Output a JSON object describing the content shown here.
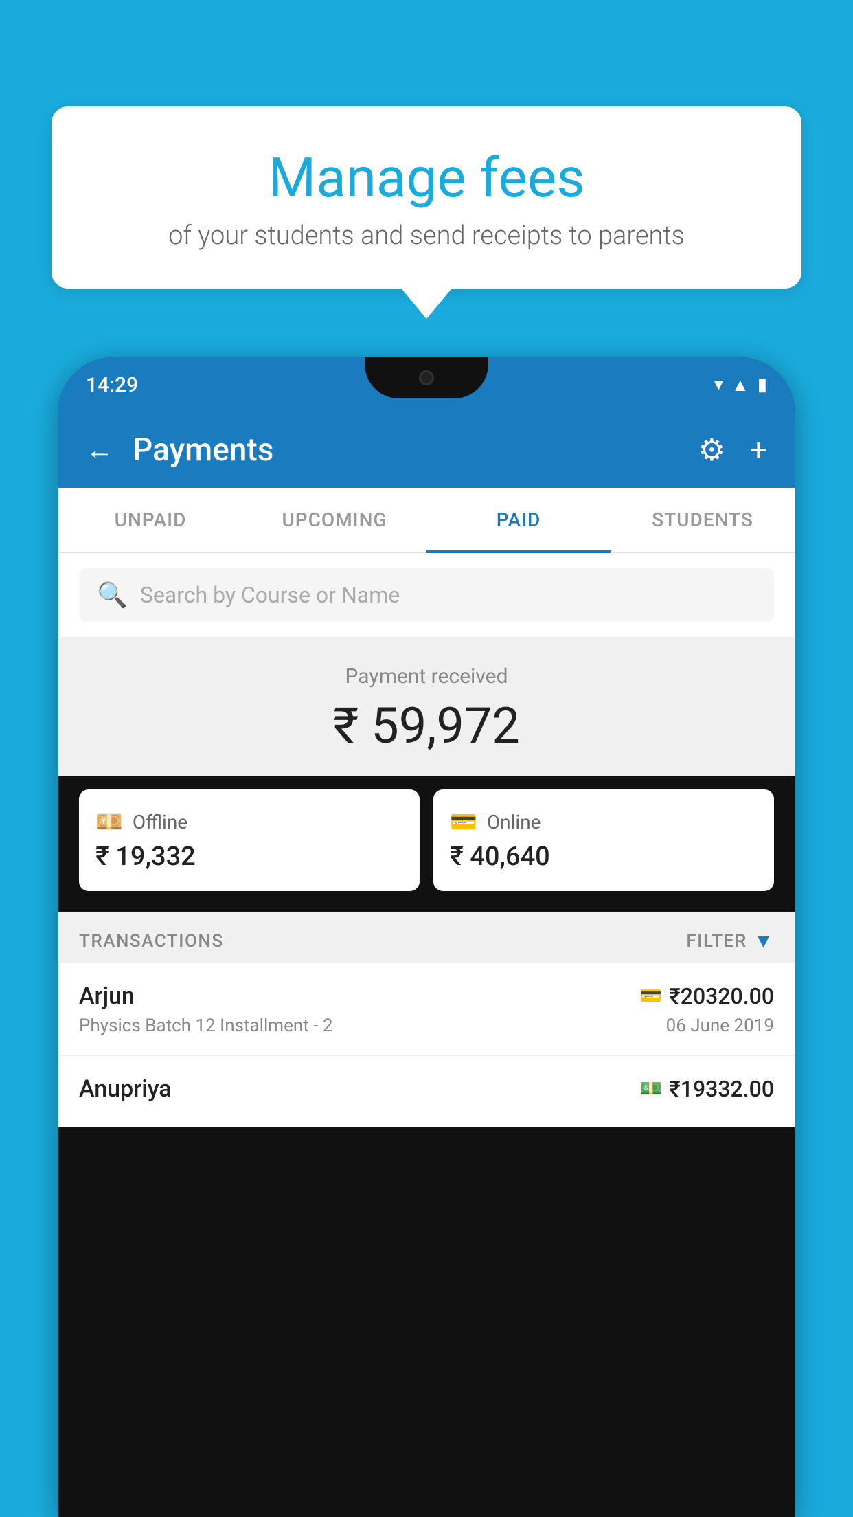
{
  "background_color": "#1AABDC",
  "bubble": {
    "title": "Manage fees",
    "subtitle": "of your students and send receipts to parents"
  },
  "phone": {
    "status_bar": {
      "time": "14:29"
    },
    "header": {
      "title": "Payments",
      "back_label": "←",
      "gear_label": "⚙",
      "plus_label": "+"
    },
    "tabs": [
      {
        "label": "UNPAID",
        "active": false
      },
      {
        "label": "UPCOMING",
        "active": false
      },
      {
        "label": "PAID",
        "active": true
      },
      {
        "label": "STUDENTS",
        "active": false
      }
    ],
    "search": {
      "placeholder": "Search by Course or Name"
    },
    "payment_summary": {
      "label": "Payment received",
      "amount": "₹ 59,972"
    },
    "payment_cards": [
      {
        "icon": "💳",
        "label": "Offline",
        "amount": "₹ 19,332"
      },
      {
        "icon": "💳",
        "label": "Online",
        "amount": "₹ 40,640"
      }
    ],
    "transactions_label": "TRANSACTIONS",
    "filter_label": "FILTER",
    "transactions": [
      {
        "name": "Arjun",
        "method_icon": "💳",
        "amount": "₹20320.00",
        "detail": "Physics Batch 12 Installment - 2",
        "date": "06 June 2019"
      },
      {
        "name": "Anupriya",
        "method_icon": "💵",
        "amount": "₹19332.00",
        "detail": "",
        "date": ""
      }
    ]
  }
}
